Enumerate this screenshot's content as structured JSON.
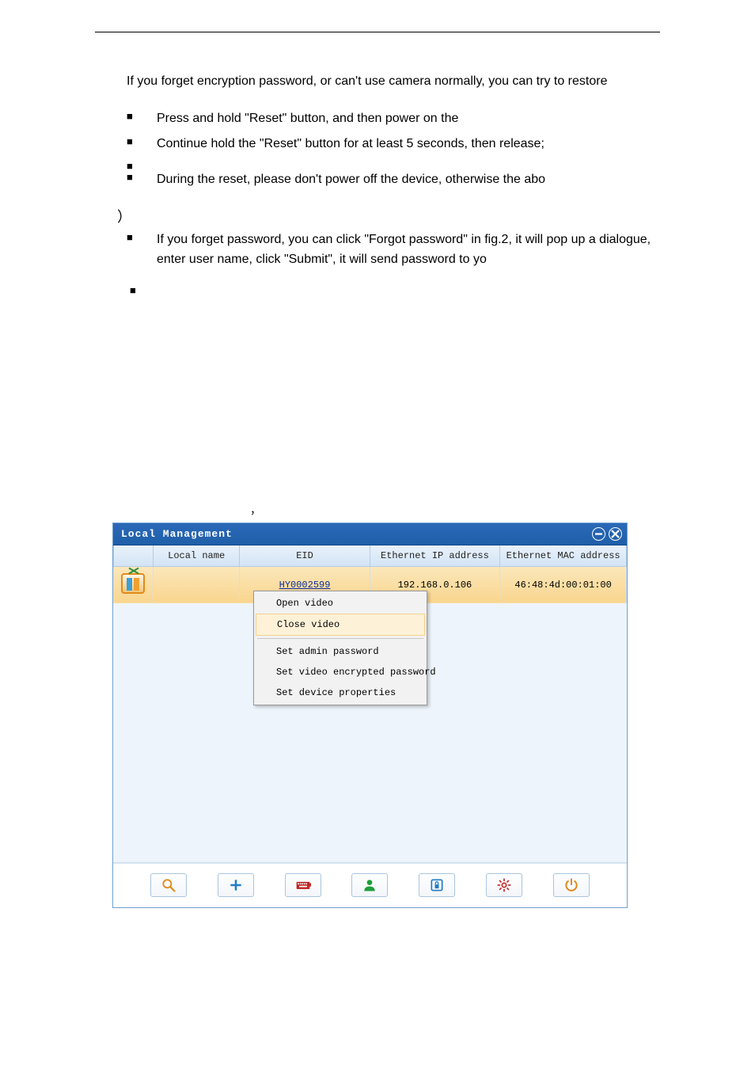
{
  "intro": "If you forget encryption password, or can't use camera normally, you can try to restore",
  "bullets_a": [
    "",
    "Press and hold \"Reset\" button, and then power on the",
    "Continue hold the \"Reset\" button for at least 5 seconds, then release;",
    ""
  ],
  "bullets_b": [
    "During the reset, please don't power off the device, otherwise the abo"
  ],
  "paren": "）",
  "bullets_c": [
    "If you forget password, you can click \"Forgot password\" in fig.2, it will pop up a dialogue, enter user name, click \"Submit\", it will send password to yo"
  ],
  "lonely_bullet": "■",
  "caption_comma": "，",
  "app": {
    "title": "Local Management",
    "columns": {
      "icon": "",
      "local_name": "Local name",
      "eid": "EID",
      "ip": "Ethernet IP address",
      "mac": "Ethernet MAC address"
    },
    "row": {
      "local_name": "",
      "eid": "HY0002599",
      "ip": "192.168.0.106",
      "mac": "46:48:4d:00:01:00"
    },
    "context_menu": [
      "Open video",
      "Close video",
      "Set admin password",
      "Set video encrypted password",
      "Set device properties"
    ],
    "toolbar": {
      "search": "search-icon",
      "add": "add-icon",
      "keyboard": "keyboard-icon",
      "user": "user-icon",
      "lock": "lock-icon",
      "settings": "gear-icon",
      "power": "power-icon"
    }
  }
}
